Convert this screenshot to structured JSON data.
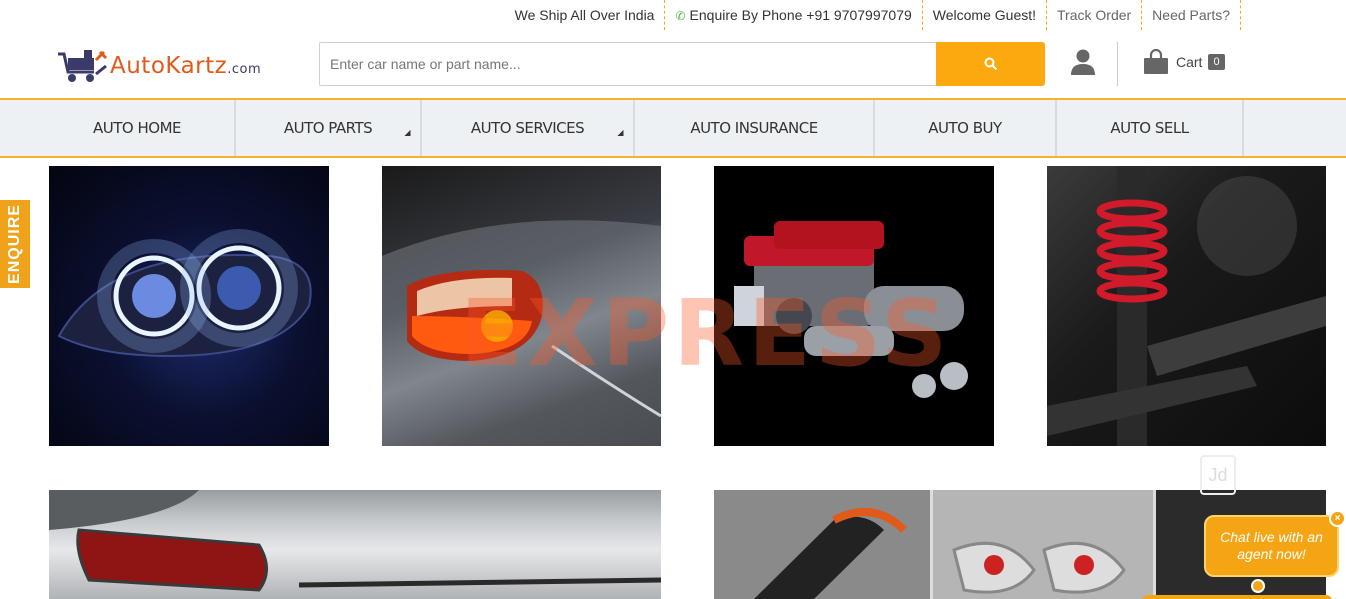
{
  "topbar": {
    "ship": "We Ship All Over India",
    "phone_label": "Enquire By Phone +91 9707997079",
    "welcome": "Welcome Guest!",
    "track": "Track Order",
    "need_parts": "Need Parts?"
  },
  "header": {
    "logo_text": "AutoKartz",
    "logo_suffix": ".com",
    "search_placeholder": "Enter car name or part name...",
    "cart_label": "Cart",
    "cart_count": "0"
  },
  "nav": {
    "items": [
      {
        "label": "AUTO HOME"
      },
      {
        "label": "AUTO PARTS"
      },
      {
        "label": "AUTO  SERVICES"
      },
      {
        "label": "AUTO INSURANCE"
      },
      {
        "label": "AUTO BUY"
      },
      {
        "label": "AUTO SELL"
      }
    ]
  },
  "enquire_tab": "ENQUIRE",
  "watermark": "EXPRESS",
  "chat": {
    "text": "Chat live with an agent now!",
    "close": "×"
  },
  "colors": {
    "accent": "#fca90f",
    "nav_bg": "#eef1f3",
    "brand": "#e05a1a"
  }
}
